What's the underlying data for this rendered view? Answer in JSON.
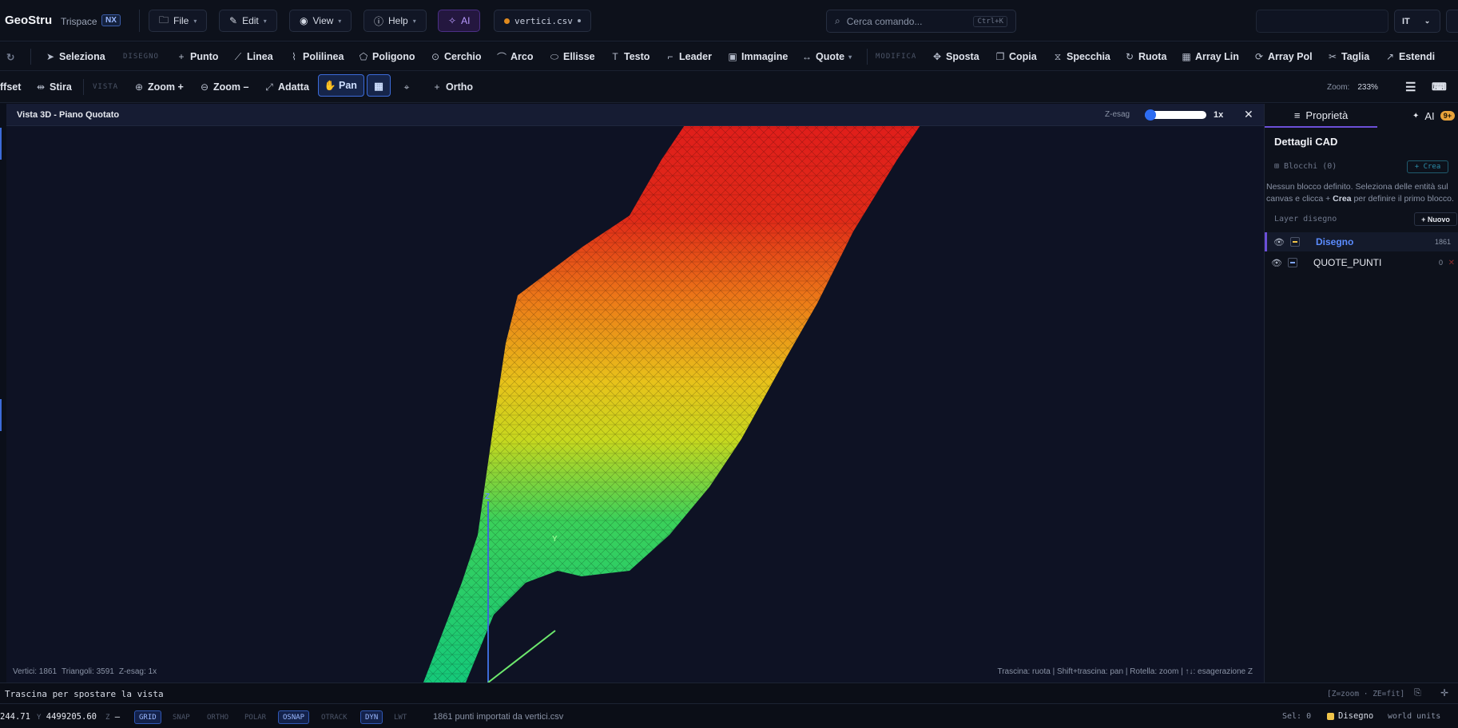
{
  "app": {
    "name": "GeoStru",
    "product": "Trispace",
    "badge": "NX"
  },
  "menus": [
    {
      "label": "File",
      "icon": "folder-icon"
    },
    {
      "label": "Edit",
      "icon": "pencil-icon"
    },
    {
      "label": "View",
      "icon": "eye-icon"
    },
    {
      "label": "Help",
      "icon": "help-circle-icon"
    },
    {
      "label": "AI",
      "icon": "sparkle-icon"
    }
  ],
  "file_tab": {
    "name": "vertici.csv"
  },
  "search": {
    "placeholder": "Cerca comando...",
    "shortcut": "Ctrl+K"
  },
  "language": "IT",
  "toolbar1": {
    "select": "Seleziona",
    "section_draw": "DISEGNO",
    "draw": [
      "Punto",
      "Linea",
      "Polilinea",
      "Poligono",
      "Cerchio",
      "Arco",
      "Ellisse",
      "Testo",
      "Leader",
      "Immagine",
      "Quote"
    ],
    "section_modify": "MODIFICA",
    "modify": [
      "Sposta",
      "Copia",
      "Specchia",
      "Ruota",
      "Array Lin",
      "Array Pol",
      "Taglia",
      "Estendi"
    ]
  },
  "toolbar2": {
    "items_a": [
      "ffset",
      "Stira"
    ],
    "section_view": "VISTA",
    "items_b": [
      "Zoom +",
      "Zoom –",
      "Adatta"
    ],
    "pan": "Pan",
    "ortho": "Ortho",
    "zoom_label": "Zoom:",
    "zoom_value": "233%"
  },
  "viewport": {
    "title": "Vista 3D - Piano Quotato",
    "zesag_label": "Z-esag",
    "zesag_value_label": "1x",
    "zesag_level": 0.0,
    "axis_labels": {
      "z": "Z",
      "y": "Y"
    },
    "footer_stats": [
      "Vertici: 1861",
      "Triangoli: 3591",
      "Z-esag: 1x"
    ],
    "footer_help": "Trascina: ruota | Shift+trascina: pan | Rotella: zoom | ↑↓: esagerazione Z"
  },
  "right_panel": {
    "tab_properties": "Proprietà",
    "tab_ai": "AI",
    "ai_badge": "9+",
    "heading": "Dettagli CAD",
    "blocks_label": "Blocchi (0)",
    "create_label": "+ Crea",
    "blocks_message_pre": "Nessun blocco definito. Seleziona delle entità sul canvas e clicca + ",
    "blocks_message_bold": "Crea",
    "blocks_message_post": " per definire il primo blocco.",
    "layers_label": "Layer disegno",
    "new_label": "+ Nuovo",
    "layers": [
      {
        "name": "Disegno",
        "count": "1861",
        "color": "#f0c44a",
        "active": true
      },
      {
        "name": "QUOTE_PUNTI",
        "count": "0",
        "color": "#7fa6ff",
        "active": false
      }
    ]
  },
  "command": {
    "prompt": "Trascina per spostare la vista",
    "hint": "[Z=zoom · ZE=fit]"
  },
  "status": {
    "x": "244.71",
    "y_label": "Y",
    "y": "4499205.60",
    "z_label": "Z",
    "z": "—",
    "toggles": [
      {
        "label": "GRID",
        "on": true
      },
      {
        "label": "SNAP",
        "on": false
      },
      {
        "label": "ORTHO",
        "on": false
      },
      {
        "label": "POLAR",
        "on": false
      },
      {
        "label": "OSNAP",
        "on": true
      },
      {
        "label": "OTRACK",
        "on": false
      },
      {
        "label": "DYN",
        "on": true
      },
      {
        "label": "LWT",
        "on": false
      }
    ],
    "message": "1861 punti importati da vertici.csv",
    "selection": "Sel: 0",
    "layer": "Disegno",
    "units": "world units"
  },
  "colors": {
    "accent": "#3c6bd8",
    "ai": "#b99bff",
    "mesh_high": "#e01b1b",
    "mesh_mid": "#d8d81e",
    "mesh_low": "#1bd07a"
  }
}
